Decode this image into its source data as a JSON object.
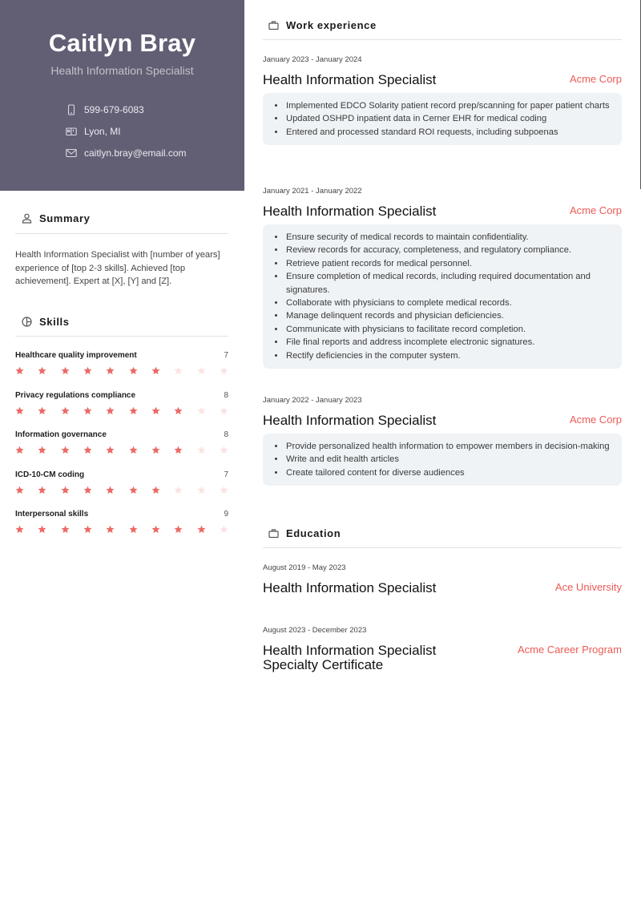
{
  "person": {
    "name": "Caitlyn Bray",
    "title": "Health Information Specialist",
    "contacts": [
      {
        "icon": "phone-icon",
        "value": "599-679-6083"
      },
      {
        "icon": "location-icon",
        "value": "Lyon, MI"
      },
      {
        "icon": "email-icon",
        "value": "caitlyn.bray@email.com"
      }
    ]
  },
  "summary": {
    "heading": "Summary",
    "icon": "person-icon",
    "text": "Health Information Specialist with [number of years] experience of [top 2-3 skills]. Achieved [top achievement]. Expert at [X], [Y] and [Z]."
  },
  "skills": {
    "heading": "Skills",
    "icon": "pie-chart-icon",
    "max": 10,
    "items": [
      {
        "name": "Healthcare quality improvement",
        "value": "7",
        "rating": 7
      },
      {
        "name": "Privacy regulations compliance",
        "value": "8",
        "rating": 8
      },
      {
        "name": "Information governance",
        "value": "8",
        "rating": 8
      },
      {
        "name": "ICD-10-CM coding",
        "value": "7",
        "rating": 7
      },
      {
        "name": "Interpersonal skills",
        "value": "9",
        "rating": 9
      }
    ]
  },
  "work": {
    "heading": "Work experience",
    "icon": "briefcase-icon",
    "entries": [
      {
        "date": "January 2023 - January 2024",
        "role": "Health Information Specialist",
        "org": "Acme Corp",
        "bullets": [
          "Implemented EDCO Solarity patient record prep/scanning for paper patient charts",
          "Updated OSHPD inpatient data in Cerner EHR for medical coding",
          "Entered and processed standard ROI requests, including subpoenas"
        ]
      },
      {
        "date": "January 2021 - January 2022",
        "role": "Health Information Specialist",
        "org": "Acme Corp",
        "bullets": [
          "Ensure security of medical records to maintain confidentiality.",
          "Review records for accuracy, completeness, and regulatory compliance.",
          "Retrieve patient records for medical personnel.",
          "Ensure completion of medical records, including required documentation and signatures.",
          "Collaborate with physicians to complete medical records.",
          "Manage delinquent records and physician deficiencies.",
          "Communicate with physicians to facilitate record completion.",
          "File final reports and address incomplete electronic signatures.",
          "Rectify deficiencies in the computer system."
        ]
      },
      {
        "date": "January 2022 - January 2023",
        "role": "Health Information Specialist",
        "org": "Acme Corp",
        "bullets": [
          "Provide personalized health information to empower members in decision-making",
          "Write and edit health articles",
          "Create tailored content for diverse audiences"
        ]
      }
    ]
  },
  "education": {
    "heading": "Education",
    "icon": "briefcase-icon",
    "entries": [
      {
        "date": "August 2019 - May 2023",
        "role": "Health Information Specialist",
        "org": "Ace University"
      },
      {
        "date": "August 2023 - December 2023",
        "role": "Health Information Specialist Specialty Certificate",
        "org": "Acme Career Program"
      }
    ]
  },
  "colors": {
    "header_bg": "#625f74",
    "accent": "#ec5b55",
    "star_on": "#ec6a66",
    "star_off": "#fbe3e2",
    "bullet_bg": "#eff3f6"
  }
}
